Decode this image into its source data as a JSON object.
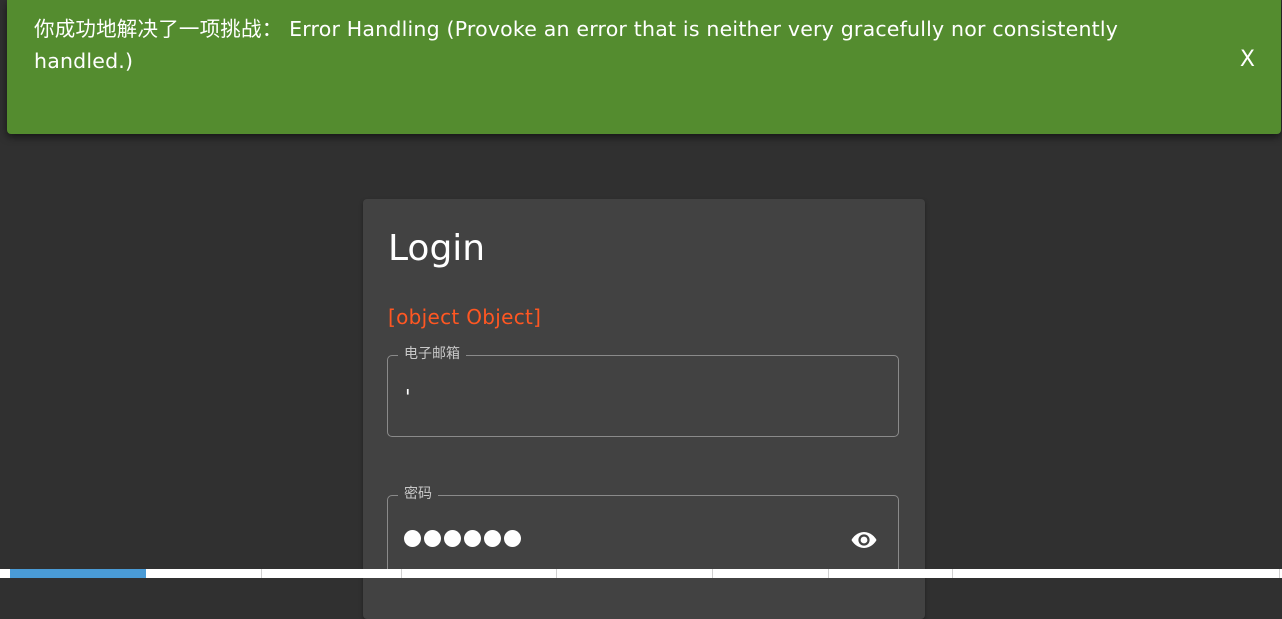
{
  "notification": {
    "message": "你成功地解决了一项挑战： Error Handling (Provoke an error that is neither very gracefully nor consistently handled.)",
    "close_label": "X",
    "color": "#548c2f"
  },
  "login": {
    "title": "Login",
    "error_message": "[object Object]",
    "error_color": "#ff5722",
    "email_label": "电子邮箱",
    "email_value": "'",
    "password_label": "密码",
    "password_mask_length": 6,
    "visibility_icon": "eye-icon"
  },
  "bottom_tabs": {
    "count": 8,
    "active_index": 0,
    "accent": "#4a9bd6"
  }
}
